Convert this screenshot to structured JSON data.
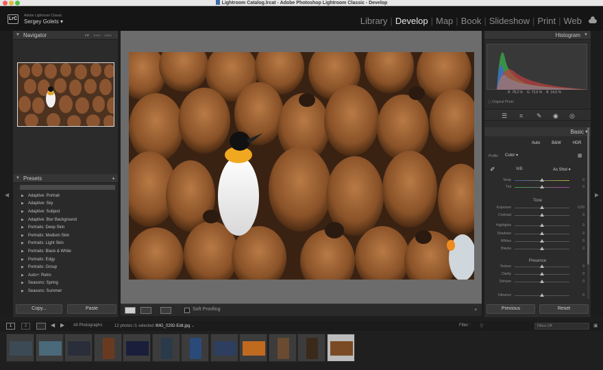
{
  "window": {
    "title": "Lightroom Catalog.lrcat - Adobe Photoshop Lightroom Classic - Develop"
  },
  "identity": {
    "app_line": "Adobe Lightroom Classic",
    "user": "Sergey Golets",
    "user_arrow": "▾",
    "logo": "LrC"
  },
  "modules": [
    "Library",
    "Develop",
    "Map",
    "Book",
    "Slideshow",
    "Print",
    "Web"
  ],
  "active_module": "Develop",
  "navigator": {
    "title": "Navigator",
    "zoom_options": [
      "FIT",
      "100%",
      "200%",
      "‹"
    ]
  },
  "presets": {
    "title": "Presets",
    "add": "+",
    "items": [
      "Adaptive: Portrait",
      "Adaptive: Sky",
      "Adaptive: Subject",
      "Adaptive: Blur Background",
      "Portraits: Deep Skin",
      "Portraits: Medium Skin",
      "Portraits: Light Skin",
      "Portraits: Black & White",
      "Portraits: Edgy",
      "Portraits: Group",
      "Auto+: Retro",
      "Seasons: Spring",
      "Seasons: Summer"
    ]
  },
  "left_buttons": {
    "copy": "Copy...",
    "paste": "Paste"
  },
  "toolbar": {
    "soft_proofing": "Soft Proofing"
  },
  "histogram": {
    "title": "Histogram",
    "r_label": "R",
    "r_value": "78,2",
    "g_label": "G",
    "g_value": "73,6",
    "b_label": "B",
    "b_value": "14,6",
    "unit": "%",
    "original_photo": "Original Photo"
  },
  "basic": {
    "title": "Basic",
    "treatment": [
      "Auto",
      "B&W",
      "HDR"
    ],
    "profile_label": "Profile",
    "profile_value": "Color",
    "wb_label": "WB",
    "wb_value": "As Shot",
    "tone_title": "Tone",
    "presence_title": "Presence",
    "rows": [
      {
        "label": "Temp",
        "value": "0"
      },
      {
        "label": "Tint",
        "value": "0"
      },
      {
        "label": "Exposure",
        "value": "0,00"
      },
      {
        "label": "Contrast",
        "value": "0"
      },
      {
        "label": "Highlights",
        "value": "0"
      },
      {
        "label": "Shadows",
        "value": "0"
      },
      {
        "label": "Whites",
        "value": "0"
      },
      {
        "label": "Blacks",
        "value": "0"
      },
      {
        "label": "Texture",
        "value": "0"
      },
      {
        "label": "Clarity",
        "value": "0"
      },
      {
        "label": "Dehaze",
        "value": "0"
      },
      {
        "label": "Vibrance",
        "value": "0"
      }
    ]
  },
  "right_buttons": {
    "previous": "Previous",
    "reset": "Reset"
  },
  "filmstrip_bar": {
    "screen1": "1",
    "screen2": "2",
    "source": "All Photographs",
    "info": "12 photos /1 selected /",
    "filename": "IMG_0292-Edit.jpg",
    "filename_arrow": "⌄",
    "filter_label": "Filter :",
    "filter_value": "Filters Off"
  },
  "filmstrip": {
    "count": 12,
    "selected_index": 11,
    "thumb_colors": [
      "#3b4a55",
      "#4a6a7a",
      "#2a2e3a",
      "#6a3a20",
      "#1a1e3a",
      "#2a3a4a",
      "#2a4a7a",
      "#2e3e5e",
      "#c06a20",
      "#6a4a30",
      "#3a2a1a",
      "#7a4a25"
    ]
  }
}
